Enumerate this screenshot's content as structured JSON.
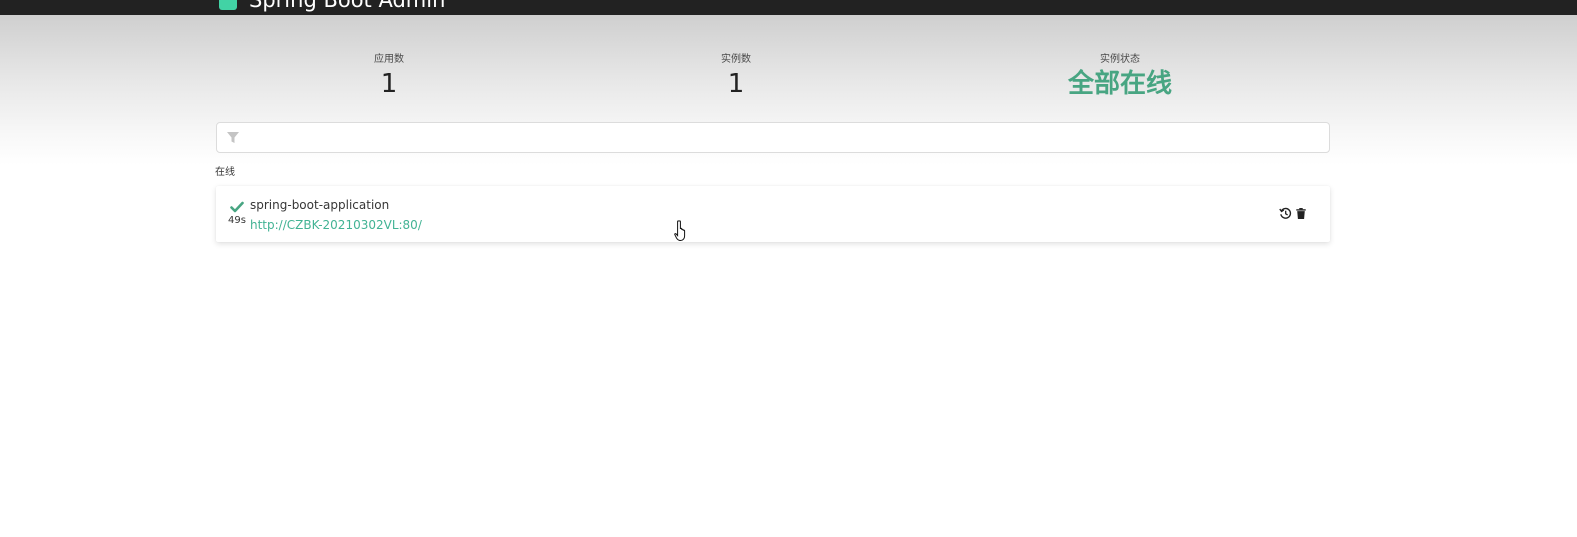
{
  "header": {
    "brand": "Spring Boot Admin"
  },
  "stats": {
    "applications_label": "应用数",
    "applications_value": "1",
    "instances_label": "实例数",
    "instances_value": "1",
    "status_label": "实例状态",
    "status_value": "全部在线"
  },
  "filter": {
    "value": "",
    "icon": "filter-icon"
  },
  "groups": [
    {
      "label": "在线",
      "applications": [
        {
          "name": "spring-boot-application",
          "url": "http://CZBK-20210302VL:80/",
          "uptime": "49s",
          "status_icon": "check-icon",
          "actions": [
            "history-icon",
            "trash-icon"
          ]
        }
      ]
    }
  ],
  "colors": {
    "topbar": "#222222",
    "brand_logo": "#42d3a5",
    "status_ok": "#48a582",
    "link": "#42b394"
  }
}
